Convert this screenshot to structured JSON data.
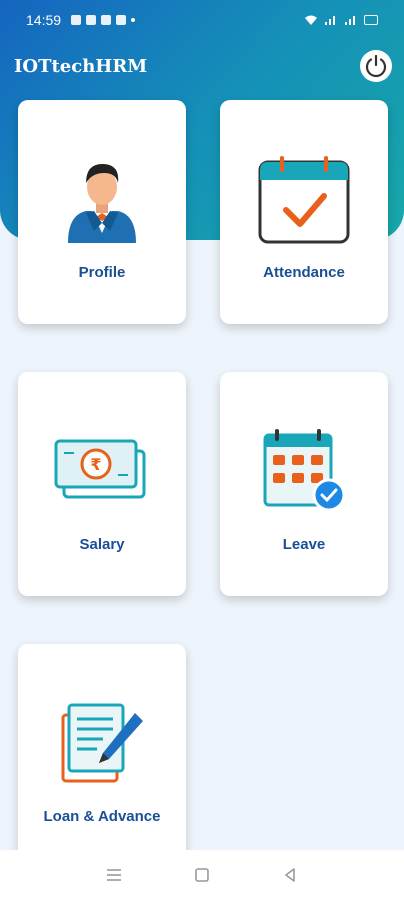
{
  "status_bar": {
    "time": "14:59"
  },
  "app": {
    "title": "IOTtechHRM"
  },
  "menu": [
    {
      "label": "Profile",
      "icon": "profile-avatar-icon"
    },
    {
      "label": "Attendance",
      "icon": "calendar-check-icon"
    },
    {
      "label": "Salary",
      "icon": "rupee-cash-icon"
    },
    {
      "label": "Leave",
      "icon": "leave-calendar-icon"
    },
    {
      "label": "Loan & Advance",
      "icon": "document-pen-icon"
    }
  ],
  "colors": {
    "header_start": "#1565c0",
    "header_end": "#17a8a8",
    "label": "#1a4f96",
    "accent": "#e8601c"
  }
}
